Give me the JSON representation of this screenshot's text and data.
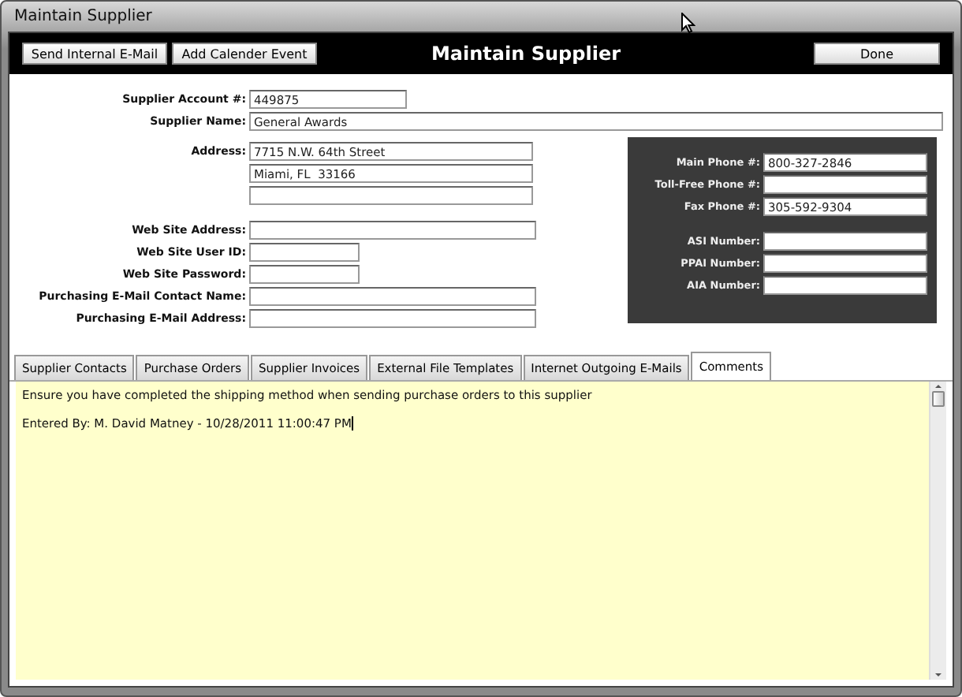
{
  "window": {
    "title": "Maintain Supplier"
  },
  "header": {
    "buttons": [
      "Send Internal E-Mail",
      "Add Calender Event"
    ],
    "title": "Maintain Supplier",
    "done": "Done"
  },
  "top_fields": [
    {
      "label": "Supplier Account #:",
      "value": "449875",
      "kind": "short"
    },
    {
      "label": "Supplier Name:",
      "value": "General Awards",
      "kind": "wide"
    }
  ],
  "address": {
    "label": "Address:",
    "lines": [
      {
        "kind": "filled",
        "value": "7715 N.W. 64th Street"
      },
      {
        "kind": "filled",
        "value": "Miami, FL  33166"
      },
      {
        "kind": "blank"
      }
    ]
  },
  "web_fields": [
    {
      "label": "Web Site Address:",
      "kind": "long"
    },
    {
      "label": "Web Site User ID:",
      "kind": "short"
    },
    {
      "label": "Web Site Password:",
      "kind": "short"
    },
    {
      "label": "Purchasing E-Mail Contact Name:",
      "kind": "long"
    },
    {
      "label": "Purchasing E-Mail Address:",
      "kind": "long"
    }
  ],
  "phones": [
    {
      "label": "Main Phone #:",
      "value": "800-327-2846"
    },
    {
      "label": "Toll-Free Phone #:"
    },
    {
      "label": "Fax Phone #:",
      "value": "305-592-9304"
    }
  ],
  "numbers": [
    {
      "label": "ASI Number:"
    },
    {
      "label": "PPAI Number:"
    },
    {
      "label": "AIA Number:"
    }
  ],
  "tabs": [
    {
      "label": "Supplier Contacts",
      "selected": false
    },
    {
      "label": "Purchase Orders",
      "selected": false
    },
    {
      "label": "Supplier Invoices",
      "selected": false
    },
    {
      "label": "External File Templates",
      "selected": false
    },
    {
      "label": "Internet Outgoing E-Mails",
      "selected": false
    },
    {
      "label": "Comments",
      "selected": true
    }
  ],
  "comments": [
    "Ensure you have completed the shipping method when sending purchase orders to this supplier",
    "Entered By: M. David Matney  -  10/28/2011 11:00:47 PM"
  ]
}
